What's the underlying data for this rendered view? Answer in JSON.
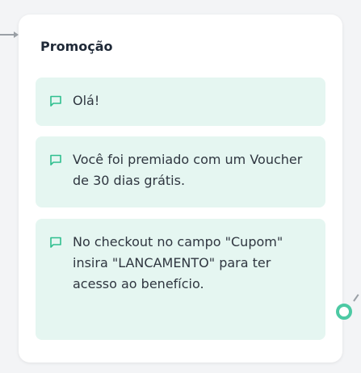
{
  "card": {
    "title": "Promoção"
  },
  "messages": [
    {
      "text": "Olá!",
      "icon": "message-icon"
    },
    {
      "text": "Você foi premiado com um Voucher de 30 dias grátis.",
      "icon": "message-icon"
    },
    {
      "text": "No checkout no campo \"Cupom\" insira \"LANCAMENTO\" para ter acesso ao benefício.",
      "icon": "message-icon"
    }
  ],
  "colors": {
    "accent": "#4cc9a3",
    "message_bg": "#e5f6f1",
    "card_bg": "#ffffff",
    "canvas_bg": "#f3f4f6"
  }
}
